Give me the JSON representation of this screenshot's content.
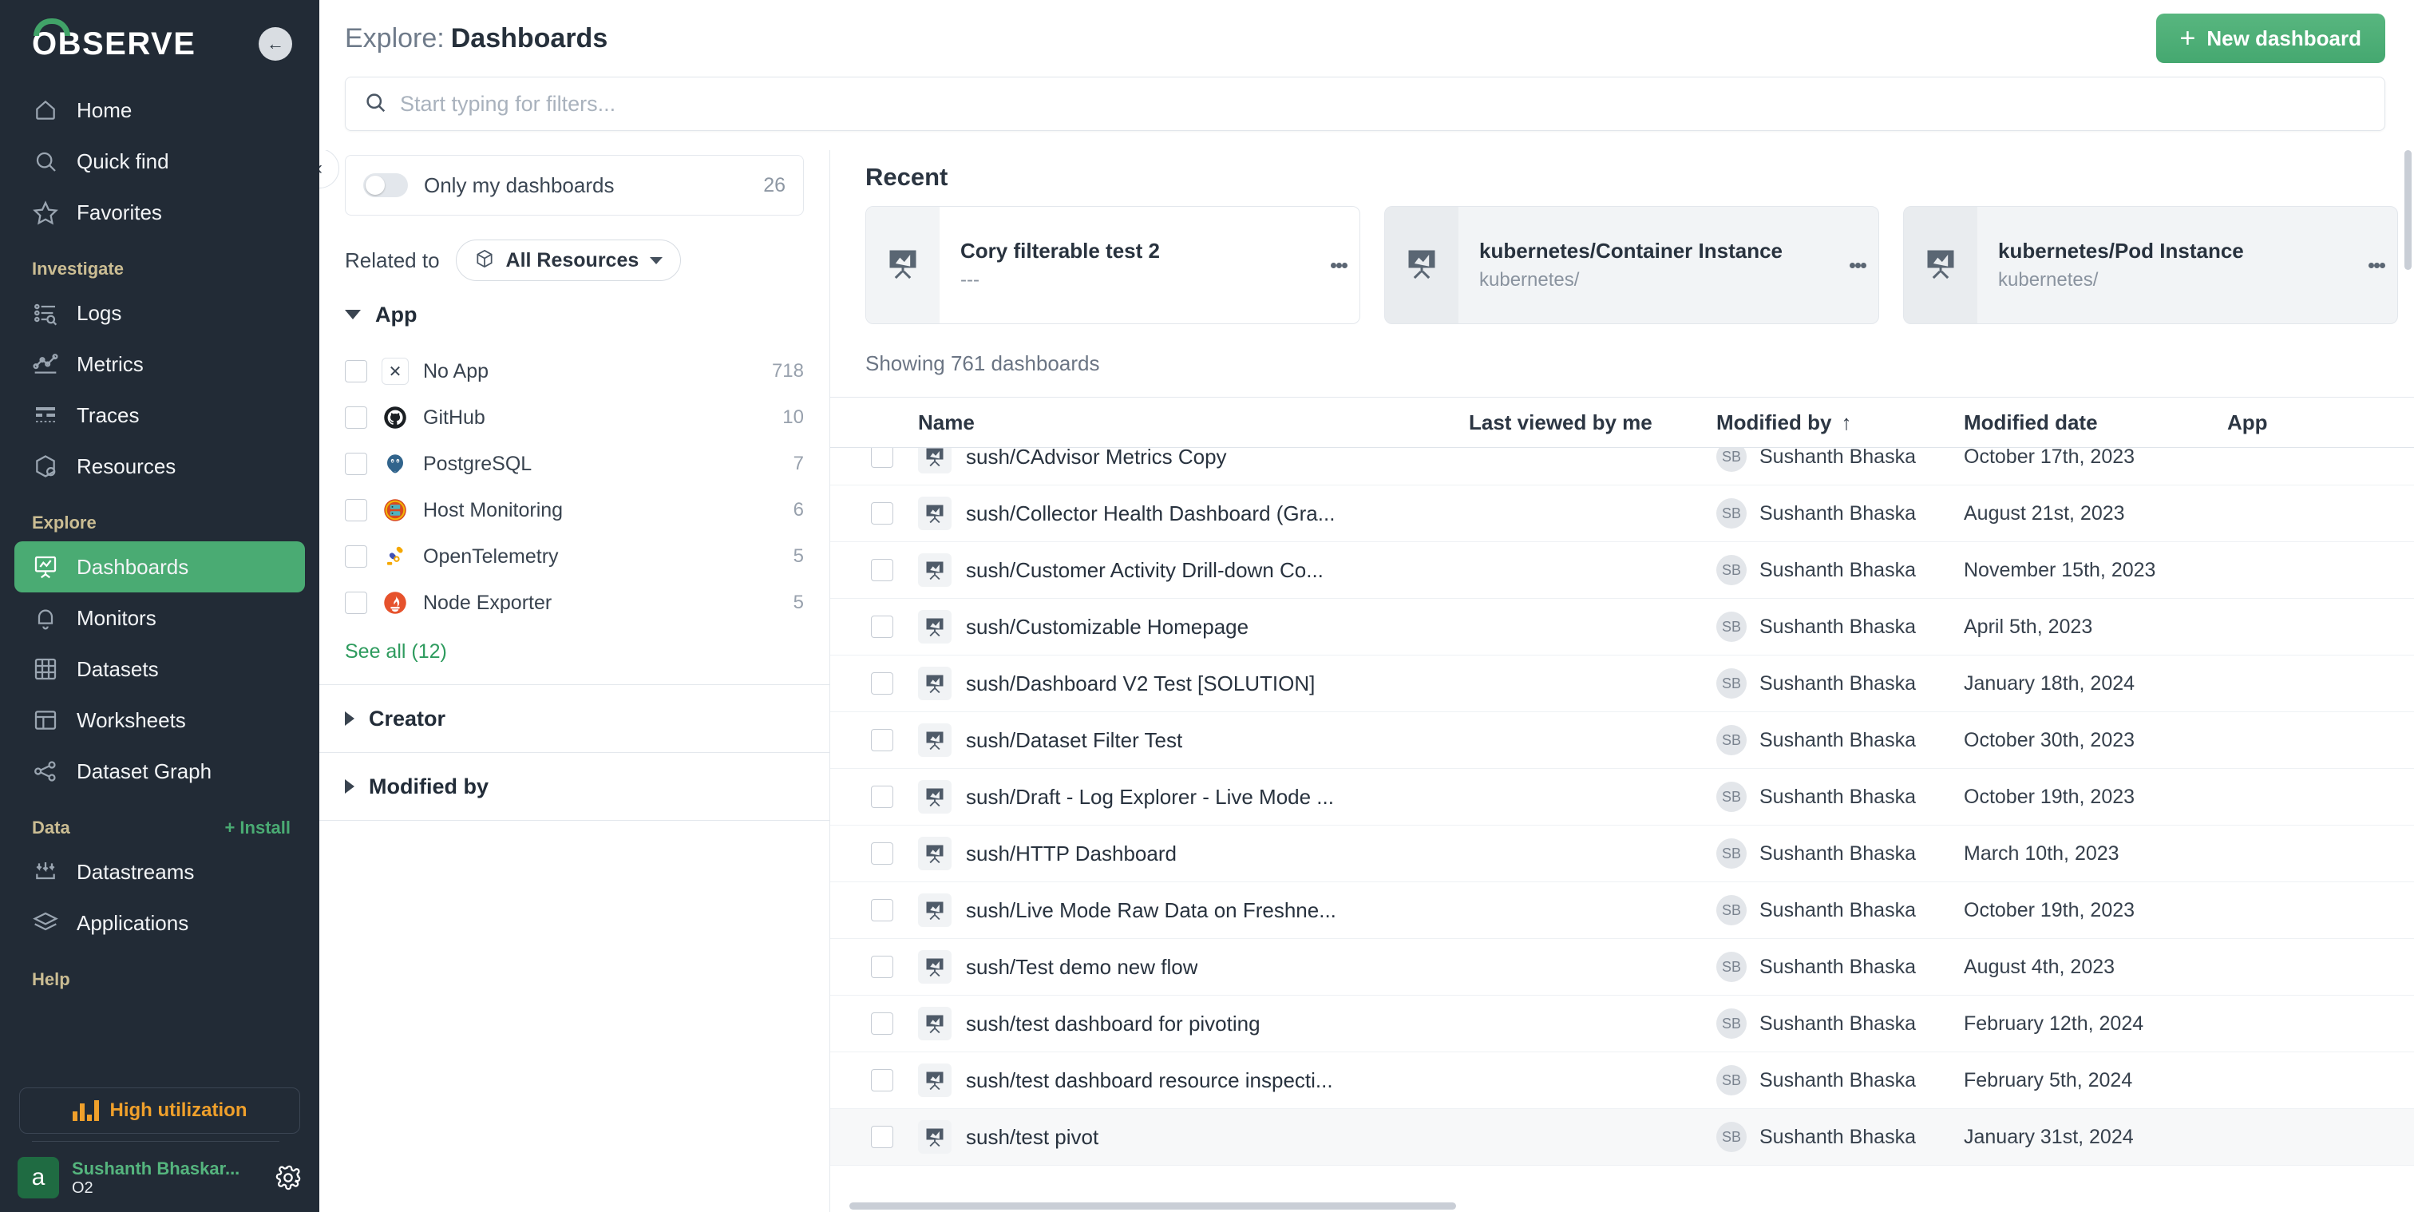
{
  "brand": {
    "name": "OBSERVE",
    "collapse_icon": "arrow-left-icon"
  },
  "sidebar": {
    "primary": [
      {
        "label": "Home",
        "icon": "home-icon"
      },
      {
        "label": "Quick find",
        "icon": "search-icon"
      },
      {
        "label": "Favorites",
        "icon": "star-icon"
      }
    ],
    "sections": [
      {
        "title": "Investigate",
        "items": [
          {
            "label": "Logs",
            "icon": "logs-icon"
          },
          {
            "label": "Metrics",
            "icon": "metrics-icon"
          },
          {
            "label": "Traces",
            "icon": "traces-icon"
          },
          {
            "label": "Resources",
            "icon": "resources-cube-icon"
          }
        ]
      },
      {
        "title": "Explore",
        "items": [
          {
            "label": "Dashboards",
            "icon": "dashboard-icon",
            "active": true
          },
          {
            "label": "Monitors",
            "icon": "bell-icon"
          },
          {
            "label": "Datasets",
            "icon": "grid-icon"
          },
          {
            "label": "Worksheets",
            "icon": "worksheet-icon"
          },
          {
            "label": "Dataset Graph",
            "icon": "graph-nodes-icon"
          }
        ]
      },
      {
        "title": "Data",
        "action": "+ Install",
        "items": [
          {
            "label": "Datastreams",
            "icon": "datastream-icon"
          },
          {
            "label": "Applications",
            "icon": "layers-icon"
          }
        ]
      },
      {
        "title": "Help",
        "items": []
      }
    ],
    "utilization_badge": "High utilization",
    "user": {
      "initial": "a",
      "name": "Sushanth Bhaskar...",
      "workspace": "O2",
      "settings_icon": "gear-icon"
    }
  },
  "header": {
    "title_prefix": "Explore:",
    "title": "Dashboards",
    "new_button": "New dashboard",
    "new_button_icon": "plus-icon"
  },
  "search": {
    "placeholder": "Start typing for filters...",
    "value": "",
    "icon": "search-icon"
  },
  "filters": {
    "only_my_dashboards": {
      "label": "Only my dashboards",
      "count": "26",
      "on": false
    },
    "related_to_label": "Related to",
    "related_to_value": "All Resources",
    "related_to_icon": "cube-icon",
    "facets": [
      {
        "title": "App",
        "expanded": true,
        "options": [
          {
            "label": "No App",
            "count": "718",
            "icon": "x-icon",
            "color": "#ffffff"
          },
          {
            "label": "GitHub",
            "count": "10",
            "icon": "github-icon",
            "color": "#1b1f23"
          },
          {
            "label": "PostgreSQL",
            "count": "7",
            "icon": "postgresql-icon",
            "color": "#31648c"
          },
          {
            "label": "Host Monitoring",
            "count": "6",
            "icon": "host-monitoring-icon",
            "color": "#d94a1f"
          },
          {
            "label": "OpenTelemetry",
            "count": "5",
            "icon": "opentelemetry-icon",
            "color": "#f5a800"
          },
          {
            "label": "Node Exporter",
            "count": "5",
            "icon": "node-exporter-icon",
            "color": "#e6522c"
          }
        ],
        "see_all": "See all (12)"
      },
      {
        "title": "Creator",
        "expanded": false,
        "options": []
      },
      {
        "title": "Modified by",
        "expanded": false,
        "options": []
      }
    ],
    "collapse_icon": "chevron-left-icon"
  },
  "recent": {
    "heading": "Recent",
    "cards": [
      {
        "title": "Cory filterable test 2",
        "subtitle": "---",
        "icon": "dashboard-icon",
        "tinted": false
      },
      {
        "title": "kubernetes/Container Instance",
        "subtitle": "kubernetes/",
        "icon": "dashboard-icon",
        "tinted": true
      },
      {
        "title": "kubernetes/Pod Instance",
        "subtitle": "kubernetes/",
        "icon": "dashboard-icon",
        "tinted": true
      }
    ]
  },
  "showing": "Showing 761 dashboards",
  "table": {
    "columns": [
      "Name",
      "Last viewed by me",
      "Modified by",
      "Modified date",
      "App"
    ],
    "sorted_column": "Modified by",
    "sort_direction": "↑",
    "rows": [
      {
        "name": "sush/CAdvisor Metrics Copy",
        "last_viewed": "",
        "modified_by": "Sushanth Bhaska",
        "initials": "SB",
        "modified_date": "October 17th, 2023",
        "app": ""
      },
      {
        "name": "sush/Collector Health Dashboard (Gra...",
        "last_viewed": "",
        "modified_by": "Sushanth Bhaska",
        "initials": "SB",
        "modified_date": "August 21st, 2023",
        "app": ""
      },
      {
        "name": "sush/Customer Activity Drill-down Co...",
        "last_viewed": "",
        "modified_by": "Sushanth Bhaska",
        "initials": "SB",
        "modified_date": "November 15th, 2023",
        "app": ""
      },
      {
        "name": "sush/Customizable Homepage",
        "last_viewed": "",
        "modified_by": "Sushanth Bhaska",
        "initials": "SB",
        "modified_date": "April 5th, 2023",
        "app": ""
      },
      {
        "name": "sush/Dashboard V2 Test [SOLUTION]",
        "last_viewed": "",
        "modified_by": "Sushanth Bhaska",
        "initials": "SB",
        "modified_date": "January 18th, 2024",
        "app": ""
      },
      {
        "name": "sush/Dataset Filter Test",
        "last_viewed": "",
        "modified_by": "Sushanth Bhaska",
        "initials": "SB",
        "modified_date": "October 30th, 2023",
        "app": ""
      },
      {
        "name": "sush/Draft - Log Explorer - Live Mode ...",
        "last_viewed": "",
        "modified_by": "Sushanth Bhaska",
        "initials": "SB",
        "modified_date": "October 19th, 2023",
        "app": ""
      },
      {
        "name": "sush/HTTP Dashboard",
        "last_viewed": "",
        "modified_by": "Sushanth Bhaska",
        "initials": "SB",
        "modified_date": "March 10th, 2023",
        "app": ""
      },
      {
        "name": "sush/Live Mode Raw Data on Freshne...",
        "last_viewed": "",
        "modified_by": "Sushanth Bhaska",
        "initials": "SB",
        "modified_date": "October 19th, 2023",
        "app": ""
      },
      {
        "name": "sush/Test demo new flow",
        "last_viewed": "",
        "modified_by": "Sushanth Bhaska",
        "initials": "SB",
        "modified_date": "August 4th, 2023",
        "app": ""
      },
      {
        "name": "sush/test dashboard for pivoting",
        "last_viewed": "",
        "modified_by": "Sushanth Bhaska",
        "initials": "SB",
        "modified_date": "February 12th, 2024",
        "app": ""
      },
      {
        "name": "sush/test dashboard resource inspecti...",
        "last_viewed": "",
        "modified_by": "Sushanth Bhaska",
        "initials": "SB",
        "modified_date": "February 5th, 2024",
        "app": ""
      },
      {
        "name": "sush/test pivot",
        "last_viewed": "",
        "modified_by": "Sushanth Bhaska",
        "initials": "SB",
        "modified_date": "January 31st, 2024",
        "app": ""
      }
    ]
  },
  "colors": {
    "accent_green": "#4aab73",
    "sidebar_bg": "#222b36",
    "warning": "#f0a02b",
    "link": "#2e9b5e"
  }
}
